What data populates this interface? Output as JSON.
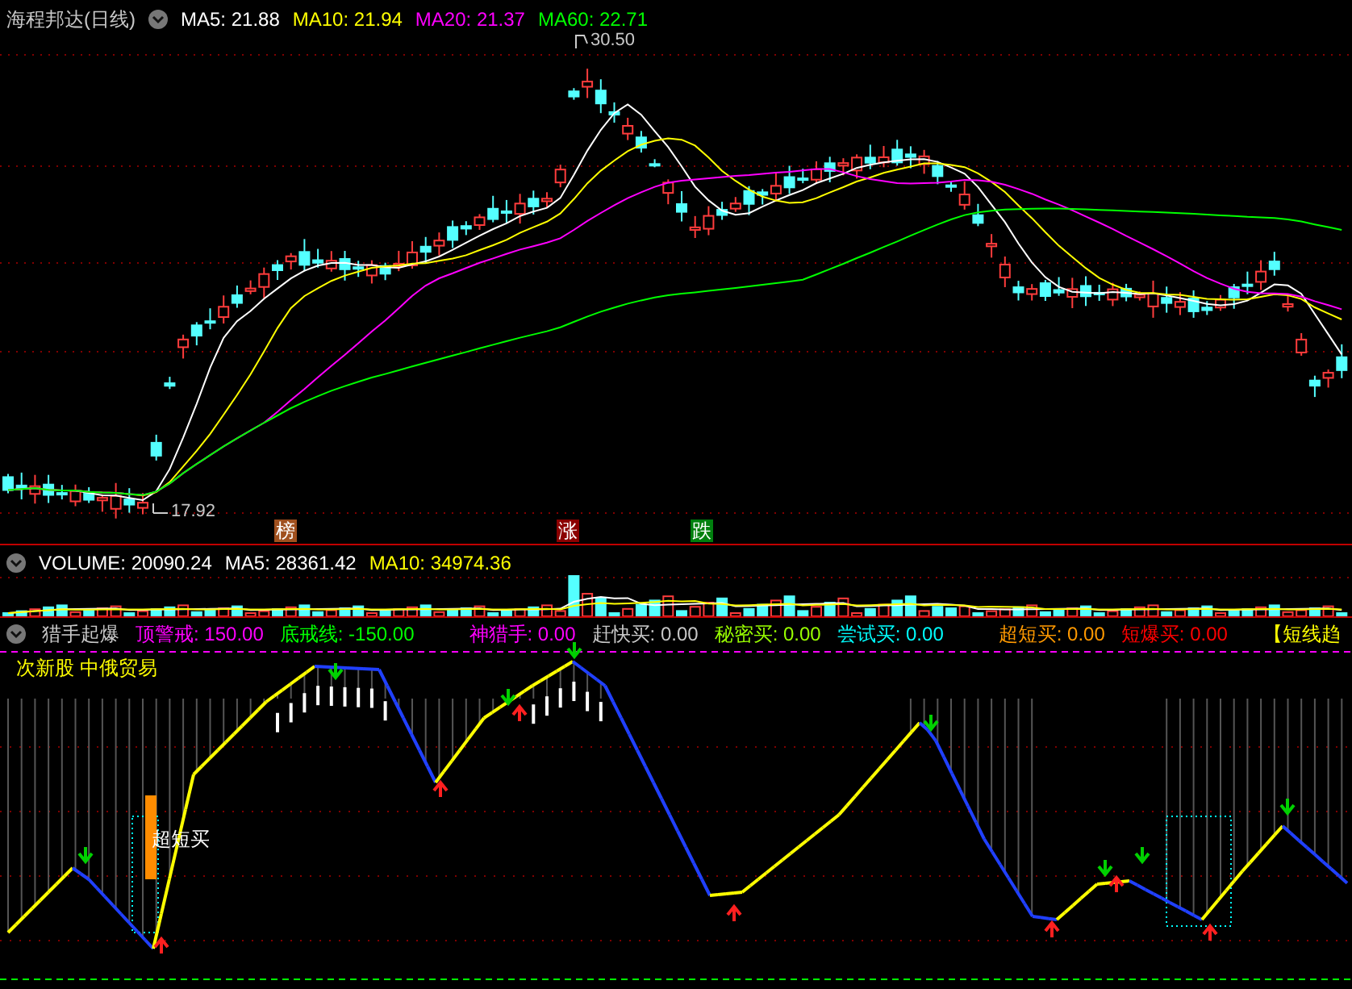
{
  "main": {
    "title": "海程邦达(日线)",
    "indicators": [
      {
        "label": "MA5: 21.88",
        "color": "#ffffff"
      },
      {
        "label": "MA10: 21.94",
        "color": "#ffff00"
      },
      {
        "label": "MA20: 21.37",
        "color": "#ff00ff"
      },
      {
        "label": "MA60: 22.71",
        "color": "#00ff00"
      }
    ],
    "high_label": "30.50",
    "low_label": "17.92",
    "markers": [
      {
        "text": "榜",
        "color": "#a0501e"
      },
      {
        "text": "涨",
        "color": "#8b0000"
      },
      {
        "text": "跌",
        "color": "#00800e"
      }
    ]
  },
  "volume": {
    "indicators": [
      {
        "label": "VOLUME: 20090.24",
        "color": "#ffffff"
      },
      {
        "label": "MA5: 28361.42",
        "color": "#ffffff"
      },
      {
        "label": "MA10: 34974.36",
        "color": "#ffff00"
      }
    ]
  },
  "indicator": {
    "title": "猎手起爆",
    "values": [
      {
        "label": "顶警戒: 150.00",
        "color": "#ff00ff"
      },
      {
        "label": "底戒线: -150.00",
        "color": "#00ff00"
      },
      {
        "label": "神猎手: 0.00",
        "color": "#ff00ff"
      },
      {
        "label": "赶快买: 0.00",
        "color": "#c8c8c8"
      },
      {
        "label": "秘密买: 0.00",
        "color": "#99ff00"
      },
      {
        "label": "尝试买: 0.00",
        "color": "#00ffff"
      },
      {
        "label": "超短买: 0.00",
        "color": "#ff9900"
      },
      {
        "label": "短爆买: 0.00",
        "color": "#ff0000"
      },
      {
        "label": "【短线趋",
        "color": "#ffff00"
      }
    ],
    "subtitle": "次新股 中俄贸易",
    "signal_label": "超短买"
  }
}
